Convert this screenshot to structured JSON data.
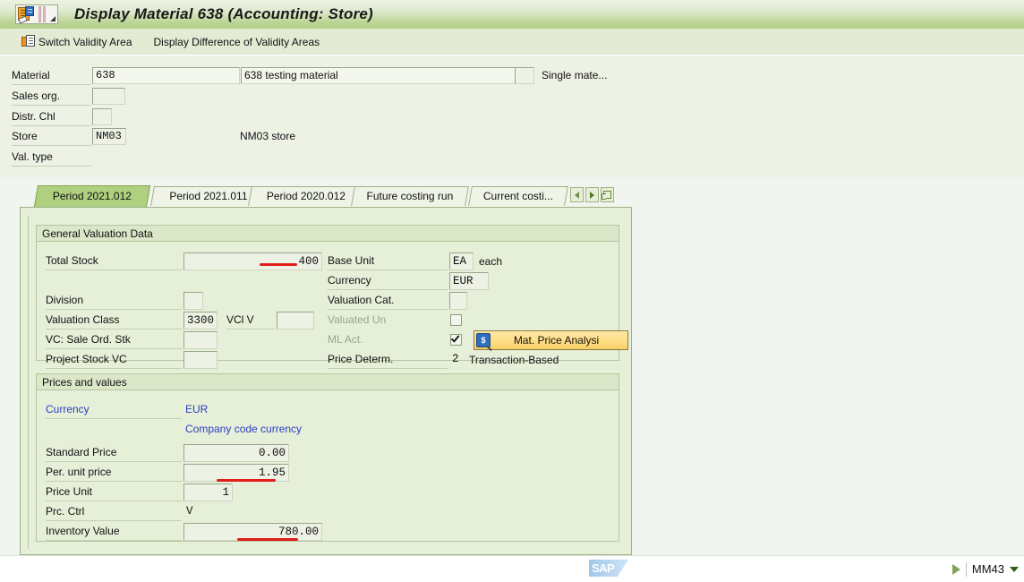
{
  "window": {
    "title": "Display Material 638 (Accounting: Store)",
    "title_icon": "material-display-icon"
  },
  "toolbar": {
    "switch_validity_area": "Switch Validity Area",
    "switch_icon": "switch-validity-icon",
    "display_difference": "Display Difference of Validity Areas"
  },
  "header": {
    "fields": [
      {
        "label": "Material",
        "value": "638",
        "description": "638 testing material",
        "suffix": "Single mate..."
      },
      {
        "label": "Sales org.",
        "value": ""
      },
      {
        "label": "Distr. Chl",
        "value": ""
      },
      {
        "label": "Store",
        "value": "NM03",
        "description": "NM03 store"
      },
      {
        "label": "Val. type",
        "value": ""
      }
    ]
  },
  "tabs": {
    "items": [
      {
        "label": "Period 2021.012",
        "active": true
      },
      {
        "label": "Period 2021.011",
        "active": false
      },
      {
        "label": "Period 2020.012",
        "active": false
      },
      {
        "label": "Future costing run",
        "active": false
      },
      {
        "label": "Current costi...",
        "active": false
      }
    ],
    "nav": {
      "prev_icon": "chevron-left-icon",
      "next_icon": "chevron-right-icon",
      "list_icon": "tab-list-icon"
    }
  },
  "general_valuation": {
    "title": "General Valuation Data",
    "total_stock_label": "Total Stock",
    "total_stock_value": "400",
    "base_unit_label": "Base Unit",
    "base_unit_value": "EA",
    "base_unit_text": "each",
    "currency_label": "Currency",
    "currency_value": "EUR",
    "division_label": "Division",
    "division_value": "",
    "valuation_cat_label": "Valuation Cat.",
    "valuation_cat_value": "",
    "valuation_class_label": "Valuation Class",
    "valuation_class_value": "3300",
    "vcl_v_label": "VCl V",
    "vcl_v_value": "",
    "valuated_un_label": "Valuated Un",
    "valuated_un_checked": false,
    "vc_sale_ord_stk_label": "VC: Sale Ord. Stk",
    "vc_sale_ord_stk_value": "",
    "ml_act_label": "ML Act.",
    "ml_act_checked": true,
    "mat_price_analysis_label": "Mat. Price Analysi",
    "mat_price_analysis_icon": "price-analysis-icon",
    "project_stock_vc_label": "Project Stock VC",
    "project_stock_vc_value": "",
    "price_determ_label": "Price Determ.",
    "price_determ_value": "2",
    "price_determ_text": "Transaction-Based"
  },
  "prices_and_values": {
    "title": "Prices and values",
    "currency_label": "Currency",
    "currency_value": "EUR",
    "company_code_currency": "Company code currency",
    "standard_price_label": "Standard Price",
    "standard_price_value": "0.00",
    "per_unit_price_label": "Per. unit price",
    "per_unit_price_value": "1.95",
    "price_unit_label": "Price Unit",
    "price_unit_value": "1",
    "prc_ctrl_label": "Prc. Ctrl",
    "prc_ctrl_value": "V",
    "inventory_value_label": "Inventory Value",
    "inventory_value_value": "780.00"
  },
  "statusbar": {
    "logo": "SAP",
    "transaction_code": "MM43",
    "play_icon": "play-icon",
    "caret_icon": "chevron-down-icon"
  },
  "colors": {
    "title_gradient_start": "#edf3e3",
    "title_gradient_end": "#b5d08c",
    "toolbar_bg": "#e4ebd5",
    "panel_bg": "#e6efd8",
    "page_bg": "#f0f5ef",
    "active_tab": "#afd07f",
    "link": "#2a3fc0",
    "annotation_red": "#e21b1b",
    "button_yellow": "#ffdf86"
  }
}
